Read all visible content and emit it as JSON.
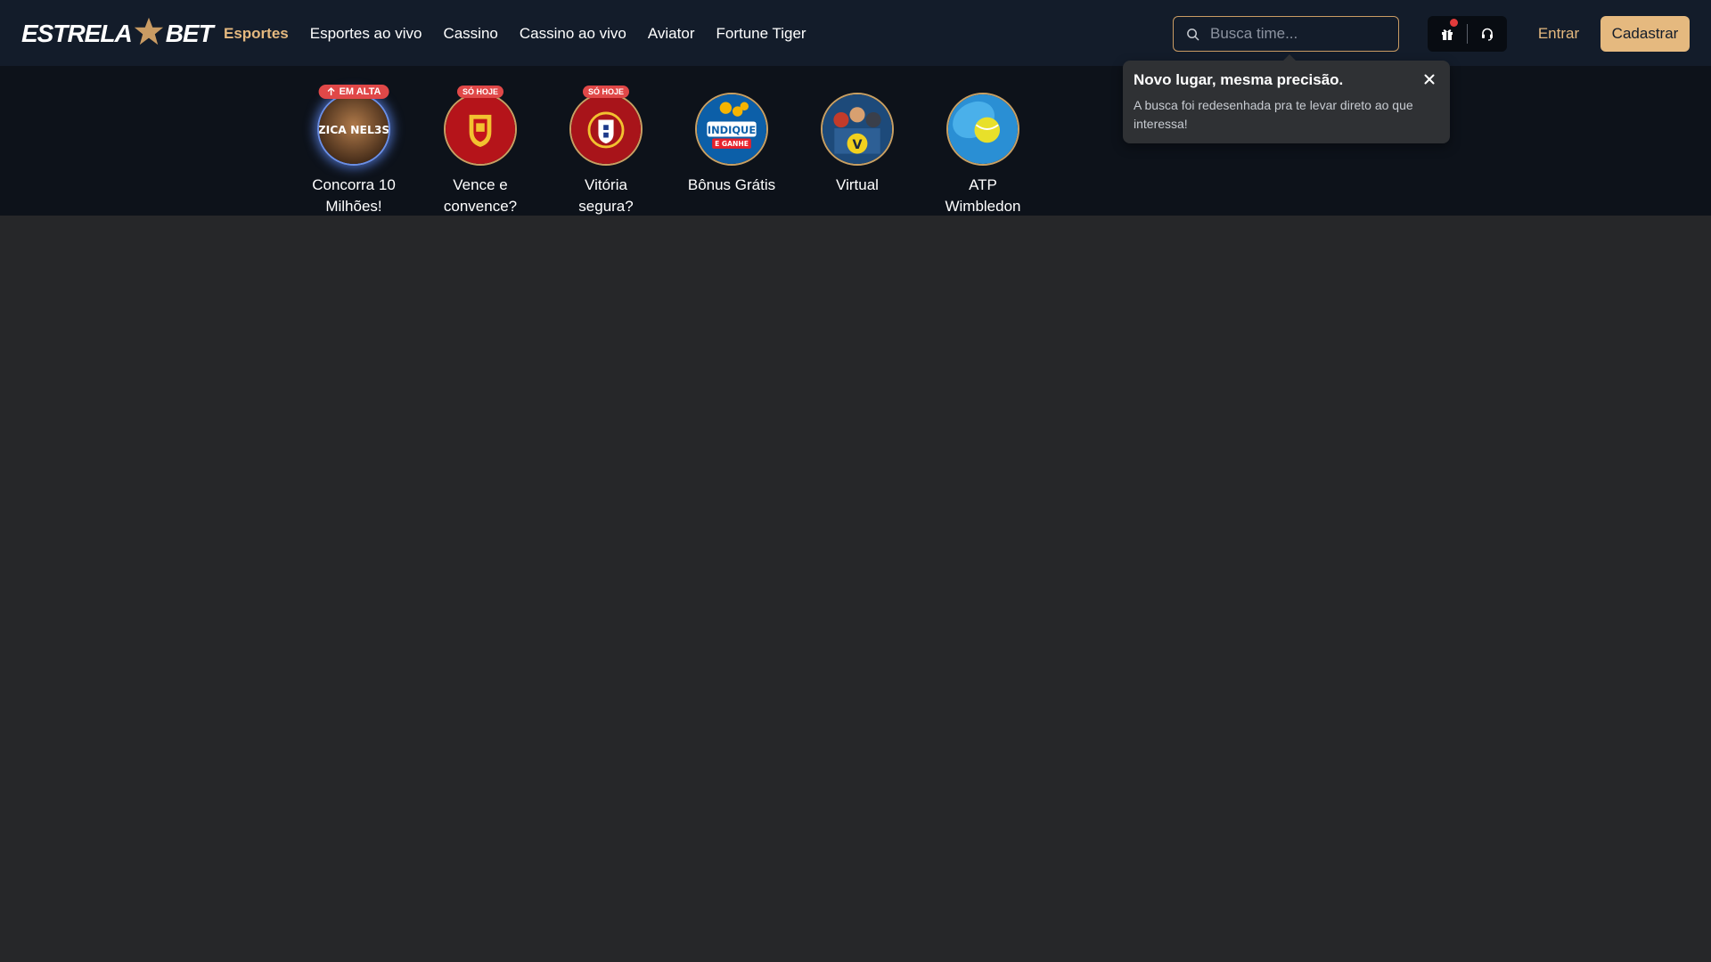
{
  "header": {
    "logo_left": "ESTRELA",
    "logo_right": "BET",
    "nav": [
      {
        "label": "Esportes",
        "active": true
      },
      {
        "label": "Esportes ao vivo"
      },
      {
        "label": "Cassino"
      },
      {
        "label": "Cassino ao vivo"
      },
      {
        "label": "Aviator"
      },
      {
        "label": "Fortune Tiger"
      }
    ],
    "search": {
      "placeholder": "Busca time..."
    },
    "login_label": "Entrar",
    "signup_label": "Cadastrar"
  },
  "stories": [
    {
      "label": "Concorra 10 Milhões!",
      "badge": "EM ALTA",
      "art_text": "ZICA NEL3S"
    },
    {
      "label": "Vence e convence?",
      "badge": "SÓ HOJE"
    },
    {
      "label": "Vitória segura?",
      "badge": "SÓ HOJE"
    },
    {
      "label": "Bônus Grátis",
      "art_text_1": "INDIQUE",
      "art_text_2": "E GANHE"
    },
    {
      "label": "Virtual",
      "art_text": "V"
    },
    {
      "label": "ATP Wimbledon"
    }
  ],
  "tooltip": {
    "title": "Novo lugar, mesma precisão.",
    "text": "A busca foi redesenhada pra te levar direto ao que interessa!"
  },
  "colors": {
    "header_bg": "#131c2a",
    "story_bg": "#0d121a",
    "page_bg": "#262729",
    "accent": "#e5b97f",
    "badge": "#e04848"
  }
}
